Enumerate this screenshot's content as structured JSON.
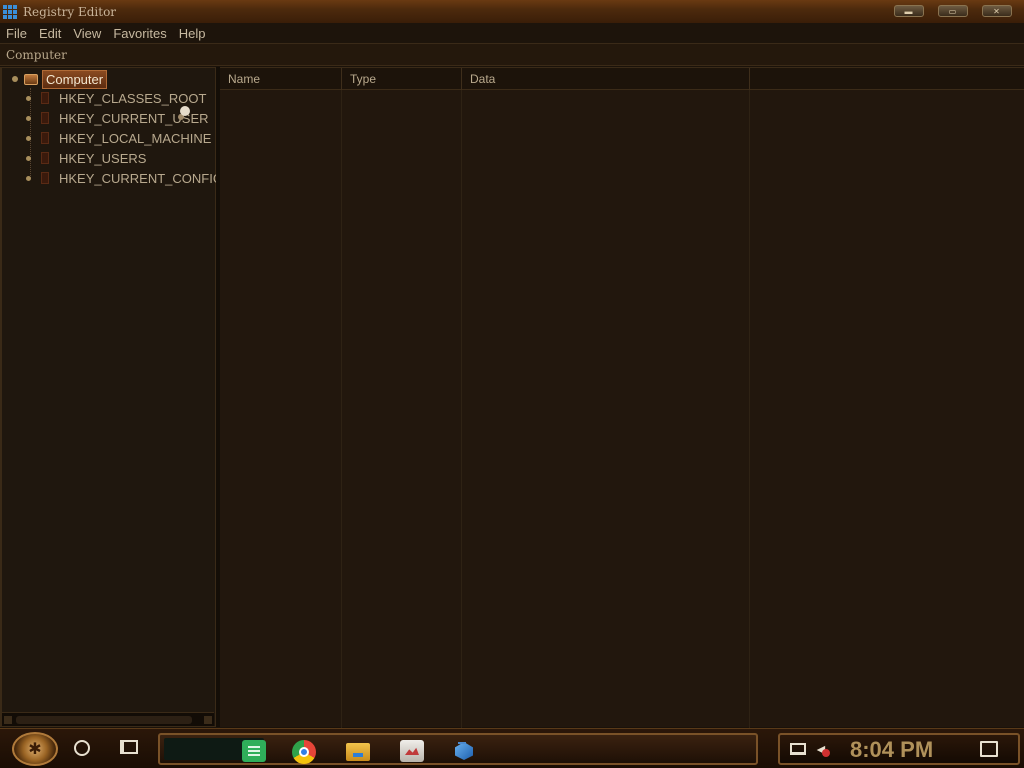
{
  "window": {
    "title": "Registry Editor",
    "controls": {
      "minimize": "▬",
      "maximize": "▭",
      "close": "✕"
    }
  },
  "menu": [
    "File",
    "Edit",
    "View",
    "Favorites",
    "Help"
  ],
  "address": "Computer",
  "tree": {
    "root": "Computer",
    "items": [
      "HKEY_CLASSES_ROOT",
      "HKEY_CURRENT_USER",
      "HKEY_LOCAL_MACHINE",
      "HKEY_USERS",
      "HKEY_CURRENT_CONFIG"
    ]
  },
  "list": {
    "columns": [
      "Name",
      "Type",
      "Data"
    ]
  },
  "taskbar": {
    "clock": "8:04 PM",
    "pinned_icons": [
      "notes-icon",
      "chrome-icon",
      "file-explorer-icon",
      "performance-monitor-icon",
      "regedit-icon"
    ]
  },
  "colors": {
    "accent": "#b0915a",
    "selection": "#8a4a20",
    "background": "#22170d"
  }
}
